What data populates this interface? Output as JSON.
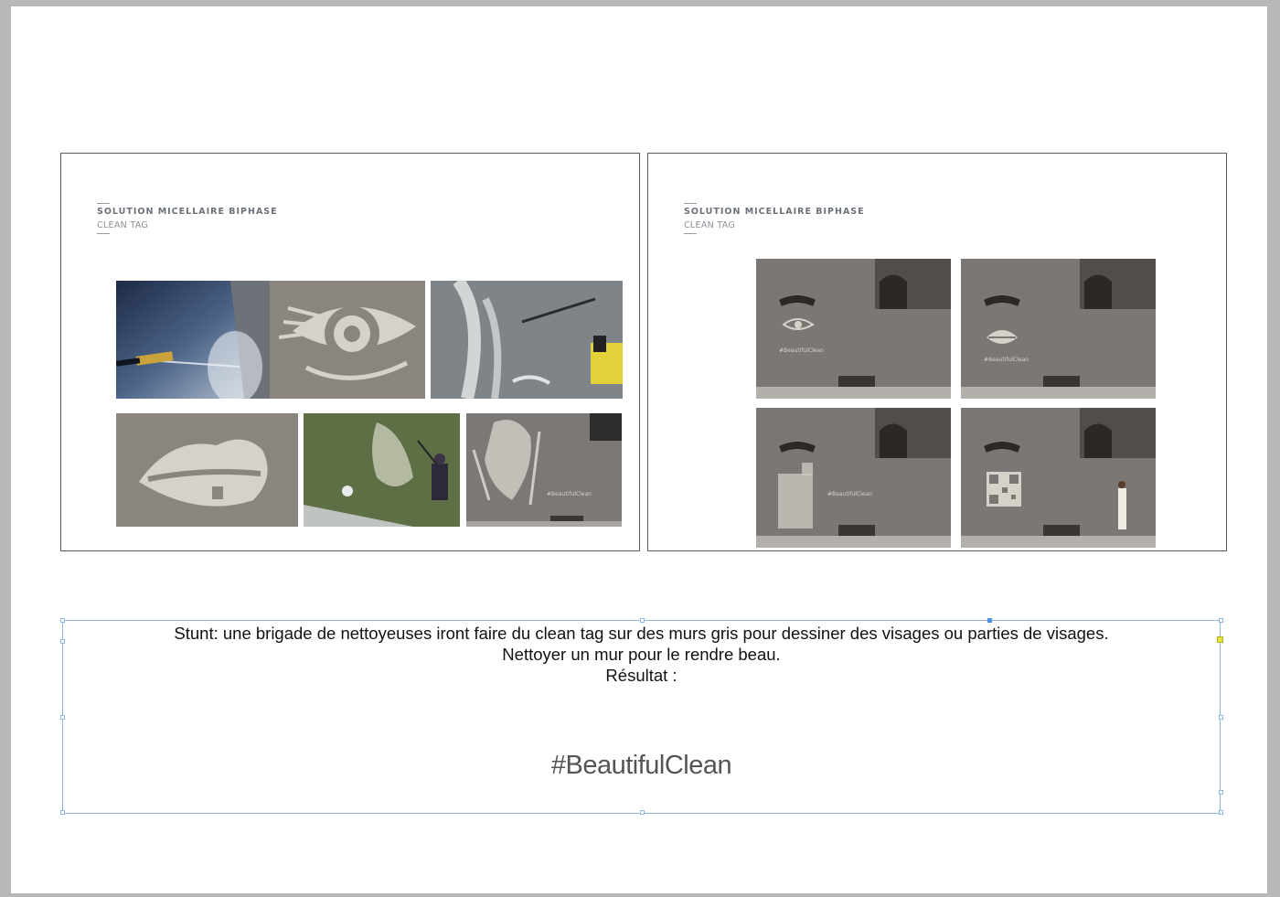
{
  "slides": [
    {
      "title": "SOLUTION MICELLAIRE BIPHASE",
      "subtitle": "CLEAN TAG"
    },
    {
      "title": "SOLUTION MICELLAIRE BIPHASE",
      "subtitle": "CLEAN TAG"
    }
  ],
  "photo_captions": {
    "face_wall": "#BeautifulClean",
    "eye_wall": "#BeautifulClean",
    "lips_wall": "#BeautifulClean",
    "bottle_wall": "#BeautifulClean"
  },
  "textframe": {
    "line1": "Stunt: une brigade de nettoyeuses iront faire du clean tag sur des murs gris pour dessiner des visages ou parties de visages.",
    "line2": "Nettoyer un mur pour le rendre beau.",
    "line3": "Résultat :",
    "hashtag": "#BeautifulClean"
  },
  "colors": {
    "frame_border": "#8fb6e6",
    "handle_blue": "#4f8ff0",
    "handle_yellow": "#e6e63a",
    "wall": "#8e8a85"
  }
}
